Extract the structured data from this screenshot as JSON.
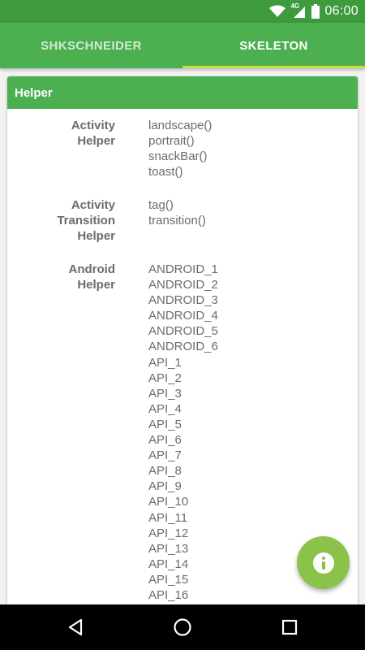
{
  "status_bar": {
    "time": "06:00",
    "network": "4G",
    "icons": [
      "wifi-icon",
      "signal-icon",
      "battery-icon"
    ]
  },
  "tabs": [
    {
      "label": "SHKSCHNEIDER",
      "active": false
    },
    {
      "label": "SKELETON",
      "active": true
    }
  ],
  "card": {
    "title": "Helper",
    "sections": [
      {
        "name_lines": [
          "Activity",
          "Helper"
        ],
        "items": [
          "landscape()",
          "portrait()",
          "snackBar()",
          "toast()"
        ]
      },
      {
        "name_lines": [
          "Activity",
          "Transition",
          "Helper"
        ],
        "items": [
          "tag()",
          "transition()"
        ]
      },
      {
        "name_lines": [
          "Android",
          "Helper"
        ],
        "items": [
          "ANDROID_1",
          "ANDROID_2",
          "ANDROID_3",
          "ANDROID_4",
          "ANDROID_5",
          "ANDROID_6",
          "API_1",
          "API_2",
          "API_3",
          "API_4",
          "API_5",
          "API_6",
          "API_7",
          "API_8",
          "API_9",
          "API_10",
          "API_11",
          "API_12",
          "API_13",
          "API_14",
          "API_15",
          "API_16"
        ]
      }
    ]
  },
  "fab": {
    "icon": "info-icon"
  },
  "nav_bar": {
    "icons": [
      "back-icon",
      "home-icon",
      "recents-icon"
    ]
  },
  "colors": {
    "primary": "#4caf50",
    "primary_dark": "#3d9a3d",
    "accent": "#cddc39",
    "fab": "#8bc34a",
    "text": "#6b6b6b"
  }
}
